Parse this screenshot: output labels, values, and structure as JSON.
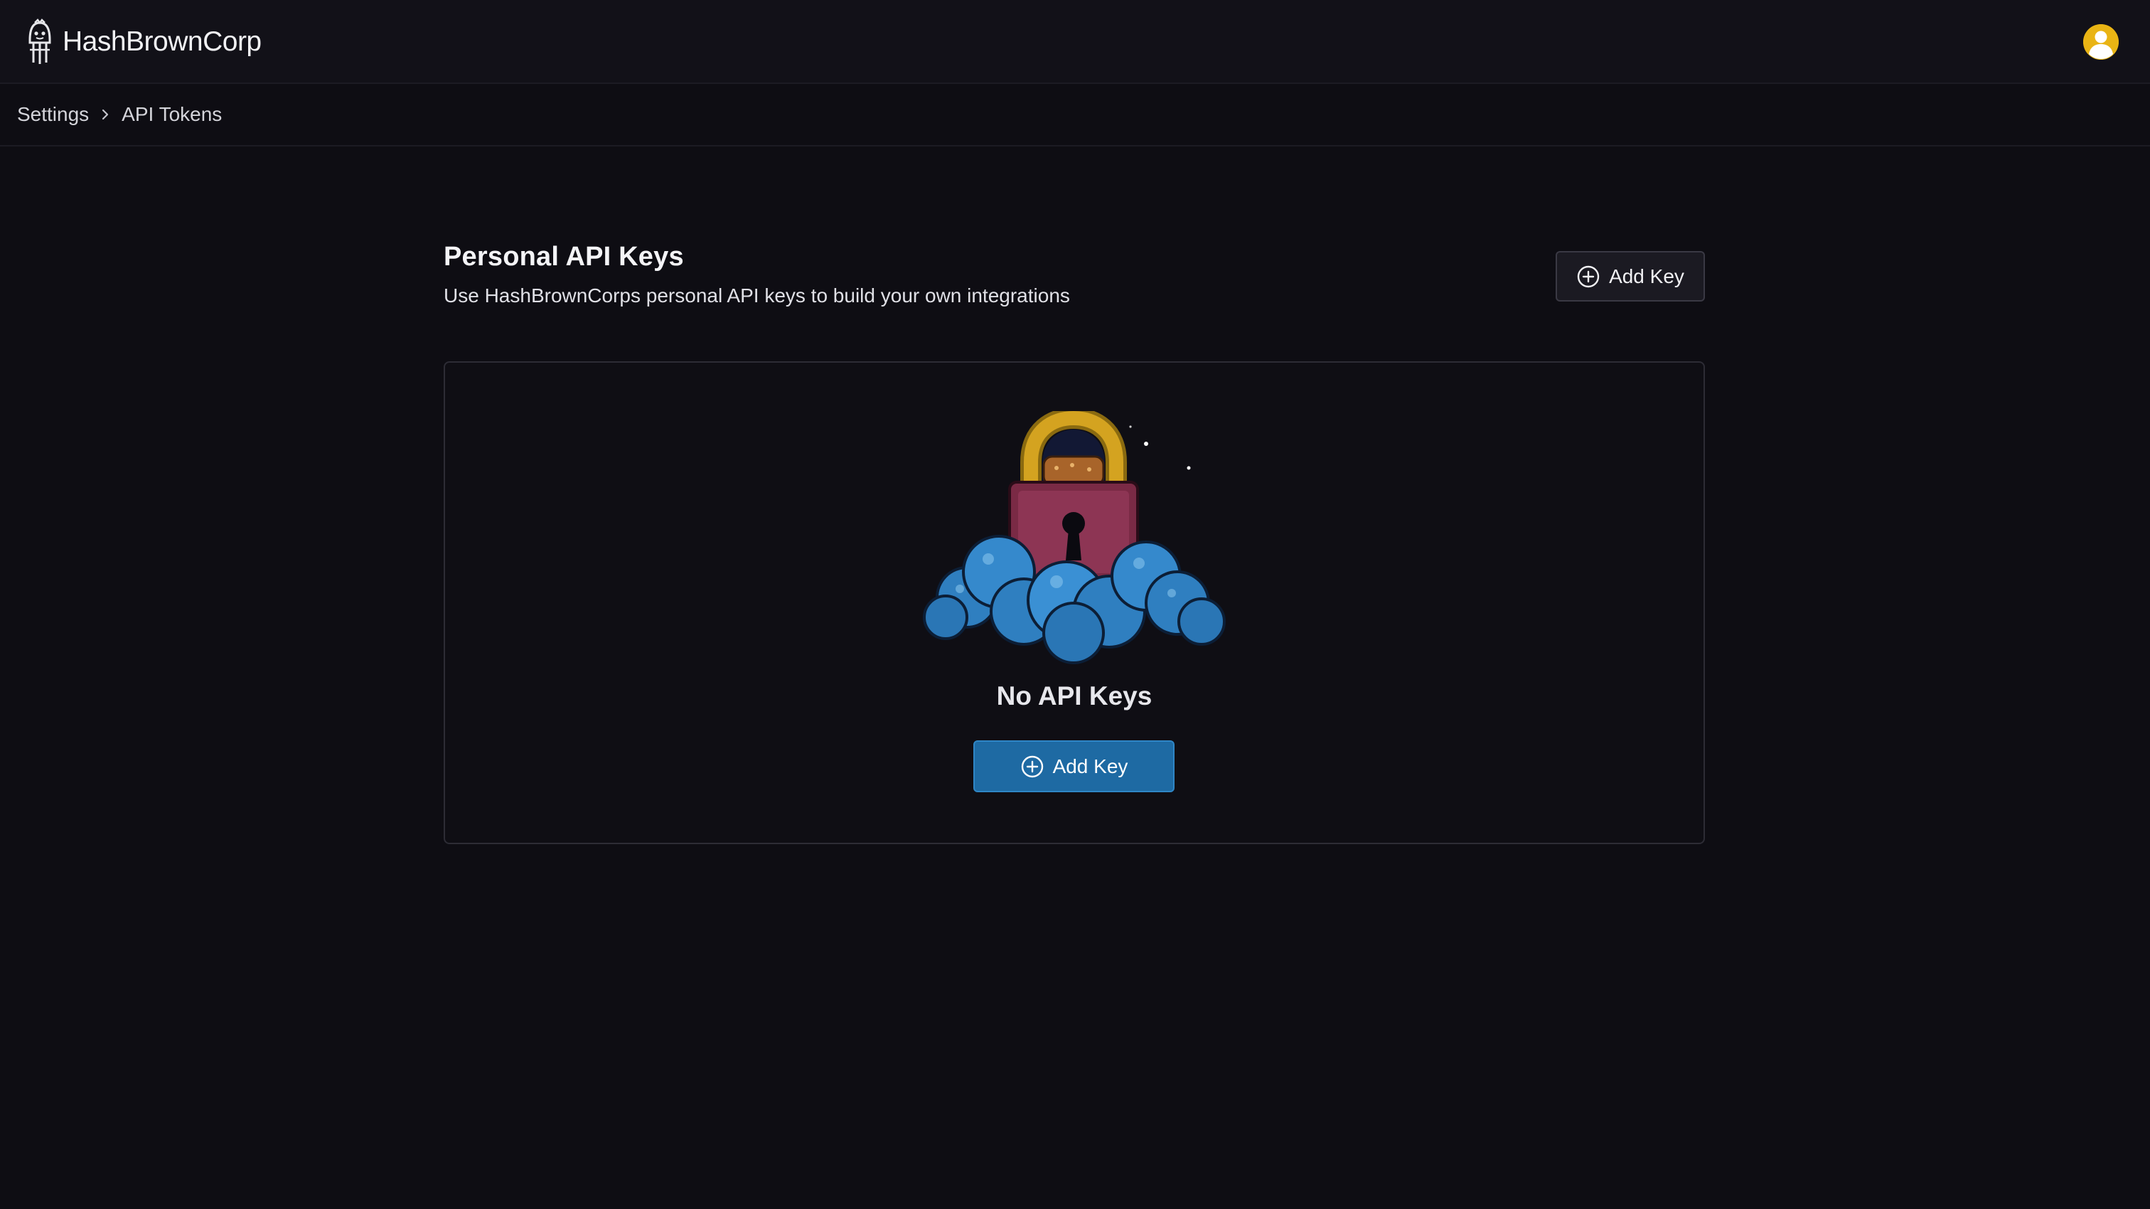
{
  "app": {
    "brand_name": "HashBrownCorp",
    "logo_icon": "hashbrown-logo-icon",
    "avatar_icon": "user-avatar-icon"
  },
  "breadcrumb": {
    "items": [
      "Settings",
      "API Tokens"
    ],
    "separator_icon": "chevron-right-icon"
  },
  "header": {
    "title": "Personal API Keys",
    "subtitle": "Use HashBrownCorps personal API keys to build your own integrations",
    "add_button_label": "Add Key",
    "add_button_icon": "plus-circle-icon"
  },
  "empty_state": {
    "illustration": "padlock-cloud-illustration",
    "title": "No API Keys",
    "add_button_label": "Add Key",
    "add_button_icon": "plus-circle-icon"
  },
  "colors": {
    "background": "#0e0d13",
    "topbar": "#121118",
    "primary_button": "#1e6aa3",
    "avatar": "#e9b414",
    "lock_body": "#7a2a45",
    "lock_shackle": "#c99a1a",
    "cloud": "#2f7fc0"
  }
}
